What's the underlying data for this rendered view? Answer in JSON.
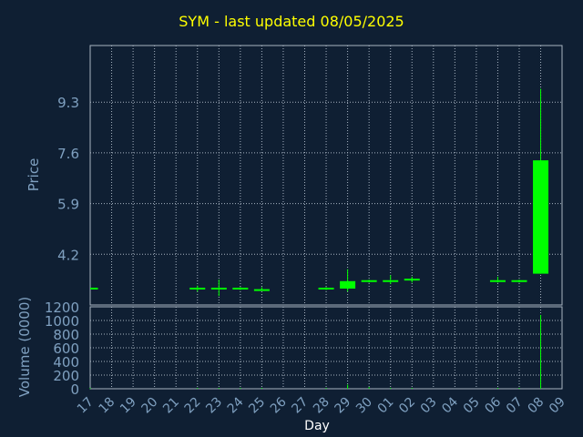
{
  "chart_data": {
    "type": "candlestick",
    "title": "SYM - last updated 08/05/2025",
    "xlabel": "Day",
    "price_panel": {
      "ylabel": "Price",
      "yticks": [
        4.2,
        5.9,
        7.6,
        9.3
      ],
      "ytick_labels": [
        "4.2",
        "5.9",
        "7.6",
        "9.3"
      ],
      "ylim": [
        2.5,
        11.2
      ]
    },
    "volume_panel": {
      "ylabel": "Volume (0000)",
      "yticks": [
        0,
        200,
        400,
        600,
        800,
        1000,
        1200
      ],
      "ytick_labels": [
        "0",
        "200",
        "400",
        "600",
        "800",
        "1000",
        "1200"
      ],
      "ylim": [
        0,
        1200
      ]
    },
    "days": [
      "17",
      "18",
      "19",
      "20",
      "21",
      "22",
      "23",
      "24",
      "25",
      "26",
      "27",
      "28",
      "29",
      "30",
      "01",
      "02",
      "03",
      "04",
      "05",
      "06",
      "07",
      "08",
      "09"
    ],
    "candles": [
      {
        "day": "17",
        "open": 3.05,
        "high": 3.05,
        "low": 3.05,
        "close": 3.05,
        "volume": 2
      },
      {
        "day": "22",
        "open": 3.05,
        "high": 3.15,
        "low": 2.95,
        "close": 3.05,
        "volume": 3
      },
      {
        "day": "23",
        "open": 3.05,
        "high": 3.35,
        "low": 2.8,
        "close": 3.05,
        "volume": 4
      },
      {
        "day": "24",
        "open": 3.05,
        "high": 3.1,
        "low": 3.0,
        "close": 3.05,
        "volume": 2
      },
      {
        "day": "25",
        "open": 3.05,
        "high": 3.1,
        "low": 3.0,
        "close": 3.0,
        "volume": 2
      },
      {
        "day": "28",
        "open": 3.05,
        "high": 3.1,
        "low": 3.0,
        "close": 3.05,
        "volume": 2
      },
      {
        "day": "29",
        "open": 3.05,
        "high": 3.7,
        "low": 2.95,
        "close": 3.3,
        "volume": 60
      },
      {
        "day": "30",
        "open": 3.3,
        "high": 3.35,
        "low": 3.25,
        "close": 3.3,
        "volume": 25
      },
      {
        "day": "01",
        "open": 3.3,
        "high": 3.5,
        "low": 3.2,
        "close": 3.3,
        "volume": 8
      },
      {
        "day": "02",
        "open": 3.35,
        "high": 3.45,
        "low": 3.25,
        "close": 3.35,
        "volume": 8
      },
      {
        "day": "06",
        "open": 3.3,
        "high": 3.45,
        "low": 3.25,
        "close": 3.3,
        "volume": 6
      },
      {
        "day": "07",
        "open": 3.3,
        "high": 3.35,
        "low": 3.25,
        "close": 3.3,
        "volume": 4
      },
      {
        "day": "08",
        "open": 3.55,
        "high": 9.75,
        "low": 3.55,
        "close": 7.35,
        "volume": 1080
      }
    ],
    "grid": true,
    "colors": {
      "background": "#0f1f33",
      "title": "#ffff00",
      "axis_text": "#7fa0c0",
      "grid": "#a8b4c2",
      "candle": "#00ff00"
    }
  }
}
